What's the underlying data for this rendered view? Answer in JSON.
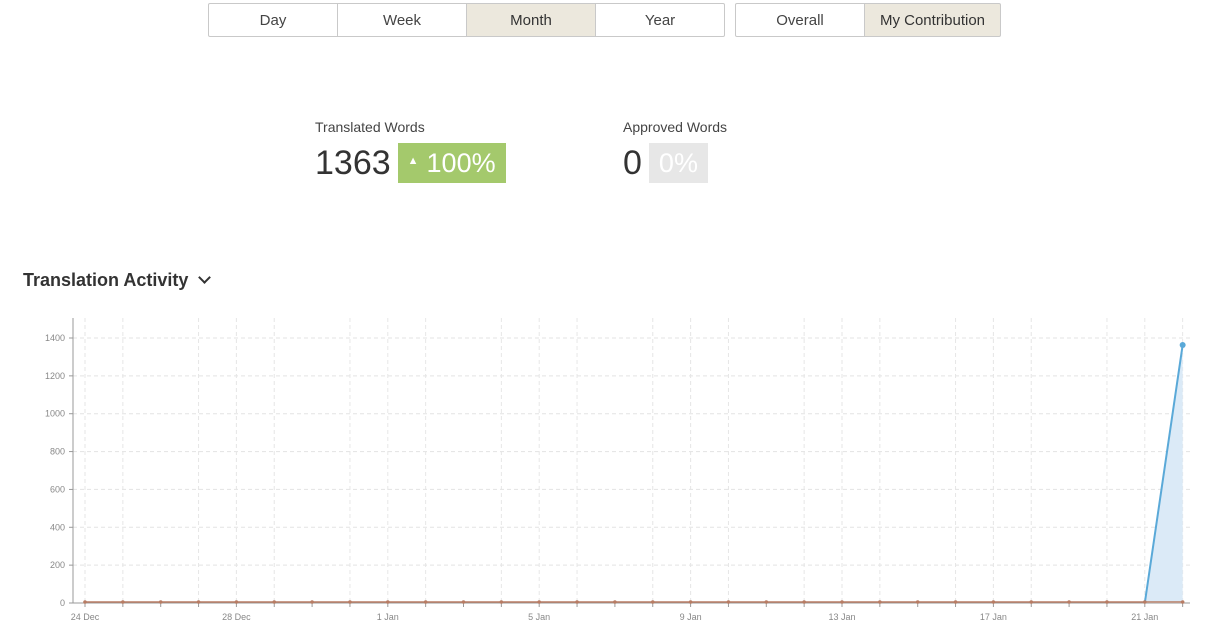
{
  "period_buttons": [
    {
      "label": "Day",
      "active": false
    },
    {
      "label": "Week",
      "active": false
    },
    {
      "label": "Month",
      "active": true
    },
    {
      "label": "Year",
      "active": false
    }
  ],
  "scope_buttons": [
    {
      "label": "Overall",
      "active": false
    },
    {
      "label": "My Contribution",
      "active": true
    }
  ],
  "stats": {
    "translated": {
      "label": "Translated Words",
      "value": "1363",
      "change": "100%"
    },
    "approved": {
      "label": "Approved Words",
      "value": "0",
      "change": "0%"
    }
  },
  "section": {
    "title": "Translation Activity"
  },
  "colors": {
    "active_button": "#ece8dd",
    "positive_badge": "#a4c96c",
    "neutral_badge": "#e7e7e7",
    "line": "#5aa9d8",
    "area": "#dbeaf7",
    "baseline": "#b87c64"
  },
  "chart_data": {
    "type": "area",
    "x": [
      "24 Dec",
      "25 Dec",
      "26 Dec",
      "27 Dec",
      "28 Dec",
      "29 Dec",
      "30 Dec",
      "31 Dec",
      "1 Jan",
      "2 Jan",
      "3 Jan",
      "4 Jan",
      "5 Jan",
      "6 Jan",
      "7 Jan",
      "8 Jan",
      "9 Jan",
      "10 Jan",
      "11 Jan",
      "12 Jan",
      "13 Jan",
      "14 Jan",
      "15 Jan",
      "16 Jan",
      "17 Jan",
      "18 Jan",
      "19 Jan",
      "20 Jan",
      "21 Jan",
      "22 Jan"
    ],
    "tick_labels": [
      "24 Dec",
      "28 Dec",
      "1 Jan",
      "5 Jan",
      "9 Jan",
      "13 Jan",
      "17 Jan",
      "21 Jan"
    ],
    "series": [
      {
        "values": [
          0,
          0,
          0,
          0,
          0,
          0,
          0,
          0,
          0,
          0,
          0,
          0,
          0,
          0,
          0,
          0,
          0,
          0,
          0,
          0,
          0,
          0,
          0,
          0,
          0,
          0,
          0,
          0,
          0,
          1363
        ]
      },
      {
        "values": [
          0,
          0,
          0,
          0,
          0,
          0,
          0,
          0,
          0,
          0,
          0,
          0,
          0,
          0,
          0,
          0,
          0,
          0,
          0,
          0,
          0,
          0,
          0,
          0,
          0,
          0,
          0,
          0,
          0,
          0
        ]
      }
    ],
    "ylim": [
      0,
      1400
    ],
    "yticks": [
      0,
      200,
      400,
      600,
      800,
      1000,
      1200,
      1400
    ],
    "grid": true
  }
}
